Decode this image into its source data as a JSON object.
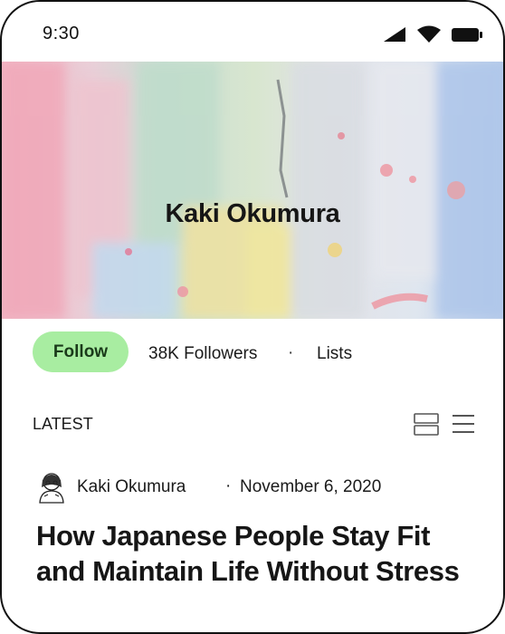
{
  "status_bar": {
    "time": "9:30",
    "icons": [
      "signal-icon",
      "wifi-icon",
      "battery-icon"
    ]
  },
  "profile": {
    "name": "Kaki Okumura",
    "banner_image": "abstract-paint-banner",
    "follow_label": "Follow",
    "followers_label": "38K Followers",
    "separator": "·",
    "lists_label": "Lists"
  },
  "feed": {
    "section_title": "LATEST",
    "view_icons": [
      "card-view-icon",
      "list-view-icon"
    ],
    "posts": [
      {
        "author": "Kaki Okumura",
        "separator": "·",
        "date": "November 6, 2020",
        "title": "How Japanese People Stay Fit and Maintain Life Without Stress"
      }
    ]
  },
  "colors": {
    "follow_button": "#a8eda1",
    "text": "#1a1a1a",
    "frame": "#111111"
  }
}
